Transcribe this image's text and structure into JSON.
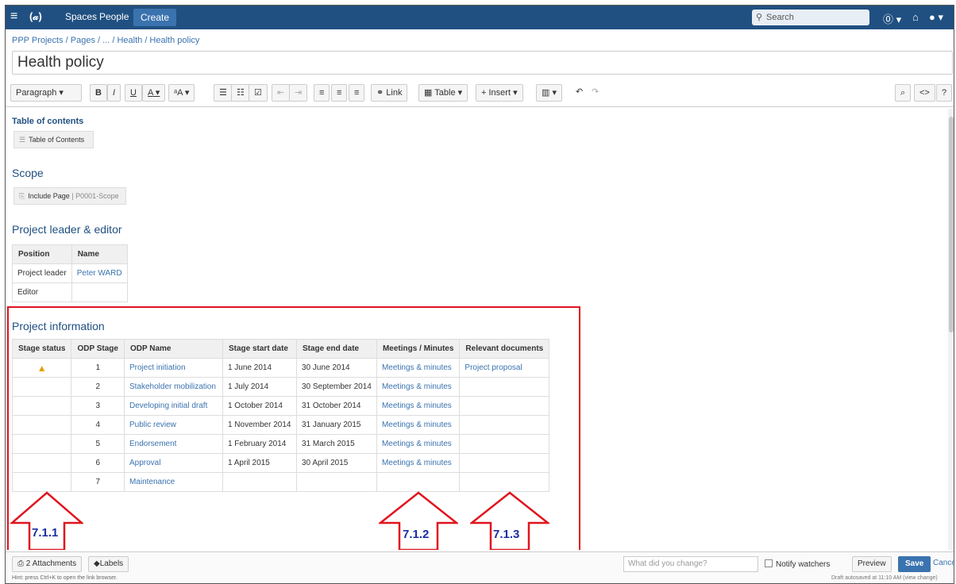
{
  "topnav": {
    "logo": "(𝒶)",
    "spaces": "Spaces",
    "people": "People",
    "create": "Create",
    "search_placeholder": "Search",
    "help_icon": "?",
    "notif_icon": "bell-icon",
    "user_icon": "user-icon"
  },
  "breadcrumb": "PPP Projects / Pages / ... / Health / Health policy",
  "title": "Health policy",
  "toolbar": {
    "paragraph": "Paragraph",
    "bold": "B",
    "italic": "I",
    "underline": "U",
    "color": "A",
    "more_format": "ᵃA",
    "bullet": "☰",
    "numbered": "☷",
    "task": "☑",
    "outdent": "⇤",
    "indent": "⇥",
    "align_left": "≡",
    "align_center": "≡",
    "align_right": "≡",
    "link": "Link",
    "table": "Table",
    "insert": "Insert",
    "layout": "▥",
    "undo": "↶",
    "redo": "↷",
    "find": "⌕",
    "source": "<>",
    "help": "?"
  },
  "toc": {
    "heading": "Table of contents",
    "macro_label": "Table of Contents"
  },
  "scope": {
    "heading": "Scope",
    "macro_label": "Include Page",
    "macro_sub": "| P0001-Scope"
  },
  "leader": {
    "heading": "Project leader & editor",
    "headers": [
      "Position",
      "Name"
    ],
    "rows": [
      [
        "Project leader",
        "Peter WARD"
      ],
      [
        "Editor",
        ""
      ]
    ]
  },
  "info": {
    "heading": "Project information",
    "headers": [
      "Stage status",
      "ODP Stage",
      "ODP Name",
      "Stage start date",
      "Stage end date",
      "Meetings / Minutes",
      "Relevant documents"
    ],
    "rows": [
      [
        "warning",
        "1",
        "Project initiation",
        "1 June 2014",
        "30 June 2014",
        "Meetings & minutes",
        "Project proposal"
      ],
      [
        "",
        "2",
        "Stakeholder mobilization",
        "1 July 2014",
        "30 September 2014",
        "Meetings & minutes",
        ""
      ],
      [
        "",
        "3",
        "Developing initial draft",
        "1 October 2014",
        "31 October 2014",
        "Meetings & minutes",
        ""
      ],
      [
        "",
        "4",
        "Public review",
        "1 November 2014",
        "31 January 2015",
        "Meetings & minutes",
        ""
      ],
      [
        "",
        "5",
        "Endorsement",
        "1 February 2014",
        "31 March 2015",
        "Meetings & minutes",
        ""
      ],
      [
        "",
        "6",
        "Approval",
        "1 April 2015",
        "30 April 2015",
        "Meetings & minutes",
        ""
      ],
      [
        "",
        "7",
        "Maintenance",
        "",
        "",
        "",
        ""
      ]
    ]
  },
  "annotations": {
    "a1": "7.1.1",
    "a2": "7.1.2",
    "a3": "7.1.3",
    "arrow_color": "#e0141e",
    "label_color": "#1b2ea0"
  },
  "bottombar": {
    "attachments": "2 Attachments",
    "labels": "Labels",
    "hint": "Hint: press Ctrl+K to open the link browser.",
    "change_placeholder": "What did you change?",
    "notify": "Notify watchers",
    "preview": "Preview",
    "save": "Save",
    "cancel": "Cancel",
    "draft": "Draft autosaved at 11:10 AM (view change)"
  }
}
